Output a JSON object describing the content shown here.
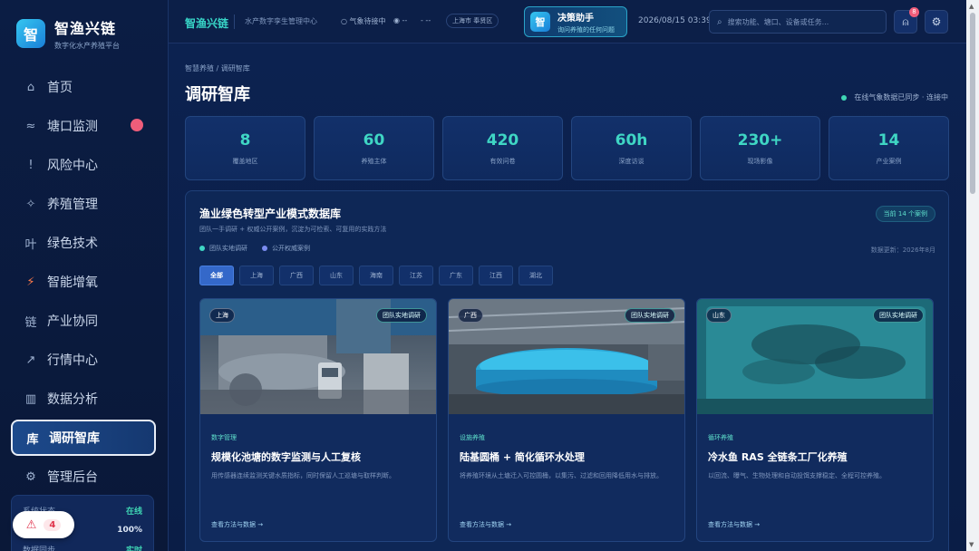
{
  "brand": {
    "logo": "智",
    "title": "智渔兴链",
    "subtitle": "数字化水产养殖平台"
  },
  "sidebar": {
    "items": [
      {
        "icon": "⌂",
        "label": "首页"
      },
      {
        "icon": "≈",
        "label": "塘口监测"
      },
      {
        "icon": "!",
        "label": "风险中心"
      },
      {
        "icon": "✧",
        "label": "养殖管理"
      },
      {
        "icon": "叶",
        "label": "绿色技术"
      },
      {
        "icon": "⚡",
        "label": "智能增氧"
      },
      {
        "icon": "链",
        "label": "产业协同"
      },
      {
        "icon": "↗",
        "label": "行情中心"
      },
      {
        "icon": "▥",
        "label": "数据分析"
      },
      {
        "icon": "库",
        "label": "调研智库"
      },
      {
        "icon": "⚙",
        "label": "管理后台"
      }
    ],
    "system": {
      "rows": [
        {
          "label": "系统状态",
          "value": "在线"
        },
        {
          "label": "",
          "value": "100%"
        },
        {
          "label": "数据同步",
          "value": "实时"
        }
      ]
    },
    "alert_count": "4"
  },
  "topbar": {
    "title": "智渔兴链",
    "subtitle": "水产数字孪生管理中心",
    "weather": "○ 气象待接中",
    "dot1": "◉ --",
    "dot2": "- --",
    "location": "上海市 奉贤区",
    "assistant": {
      "logo": "智",
      "title": "决策助手",
      "subtitle": "询问养殖的任何问题"
    },
    "time": "2026/08/15 03:39",
    "search_placeholder": "搜索功能、塘口、设备或任务...",
    "notif_count": "8"
  },
  "main": {
    "breadcrumb": "智慧养殖 / 调研智库",
    "title": "调研智库",
    "sync": "在线气象数据已同步 · 连接中",
    "stats": [
      {
        "num": "8",
        "label": "覆盖地区"
      },
      {
        "num": "60",
        "label": "养殖主体"
      },
      {
        "num": "420",
        "label": "有效问卷"
      },
      {
        "num": "60h",
        "label": "深度访谈"
      },
      {
        "num": "230+",
        "label": "现场影像"
      },
      {
        "num": "14",
        "label": "产业案例"
      }
    ],
    "panel": {
      "title": "渔业绿色转型产业模式数据库",
      "subtitle": "团队一手调研 + 权威公开案例，沉淀为可检索、可复用的实践方法",
      "count": "当前 14 个案例",
      "legend": [
        {
          "label": "团队实地调研",
          "color": "#3fd6c4"
        },
        {
          "label": "公开权威案例",
          "color": "#7b8cf0"
        }
      ],
      "updated": "数据更新：2026年8月",
      "filters": [
        "全部",
        "上海",
        "广西",
        "山东",
        "海南",
        "江苏",
        "广东",
        "江西",
        "湖北"
      ],
      "cards": [
        {
          "region": "上海",
          "type": "团队实地调研",
          "category": "数字管理",
          "title": "规模化池塘的数字监测与人工复核",
          "desc": "用传感器连续监测关键水质指标，同时保留人工巡塘与取样判断。",
          "link": "查看方法与数据 →"
        },
        {
          "region": "广西",
          "type": "团队实地调研",
          "category": "设施养殖",
          "title": "陆基圆桶 + 简化循环水处理",
          "desc": "将养殖环境从土塘迁入可控圆桶，以集污、过滤和回用降低用水与排放。",
          "link": "查看方法与数据 →"
        },
        {
          "region": "山东",
          "type": "团队实地调研",
          "category": "循环养殖",
          "title": "冷水鱼 RAS 全链条工厂化养殖",
          "desc": "以回流、曝气、生物处理和自动投饵支撑稳定、全程可控养殖。",
          "link": "查看方法与数据 →"
        }
      ]
    }
  },
  "colors": {
    "accent": "#3fd6c4",
    "active_nav": "#1d4a8c",
    "alert": "#e0364e"
  }
}
